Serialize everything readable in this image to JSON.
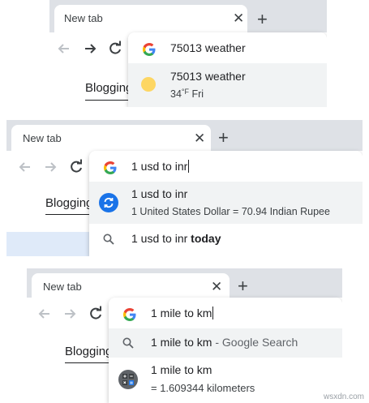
{
  "screenshots": [
    {
      "tab_title": "New tab",
      "blogging_text": "Blogging",
      "omnibox_text": "75013 weather",
      "suggestions": [
        {
          "line1": "75013 weather",
          "line2_temp": "34",
          "line2_unit": "°F",
          "line2_day": "Fri",
          "icon": "sun-weather-icon"
        }
      ]
    },
    {
      "tab_title": "New tab",
      "blogging_text": "Blogging",
      "omnibox_text": "1 usd to inr",
      "suggestions": [
        {
          "line1": "1 usd to inr",
          "line2": "1 United States Dollar = 70.94 Indian Rupee",
          "icon": "currency-convert-icon"
        },
        {
          "line1_plain": "1 usd to inr ",
          "line1_bold": "today",
          "icon": "search-icon"
        }
      ]
    },
    {
      "tab_title": "New tab",
      "blogging_text": "Blogging",
      "omnibox_text": "1 mile to km",
      "suggestions": [
        {
          "line1_plain": "1 mile to km",
          "line1_suffix": " - Google Search",
          "icon": "search-icon"
        },
        {
          "line1": "1 mile to km",
          "line2": "= 1.609344 kilometers",
          "icon": "calculator-icon"
        }
      ]
    }
  ],
  "watermark": "wsxdn.com",
  "colors": {
    "chrome_frame": "#dee1e6",
    "blue_accent": "#1a73e8",
    "sun": "#fdd663",
    "band": "#dfeaf9"
  }
}
